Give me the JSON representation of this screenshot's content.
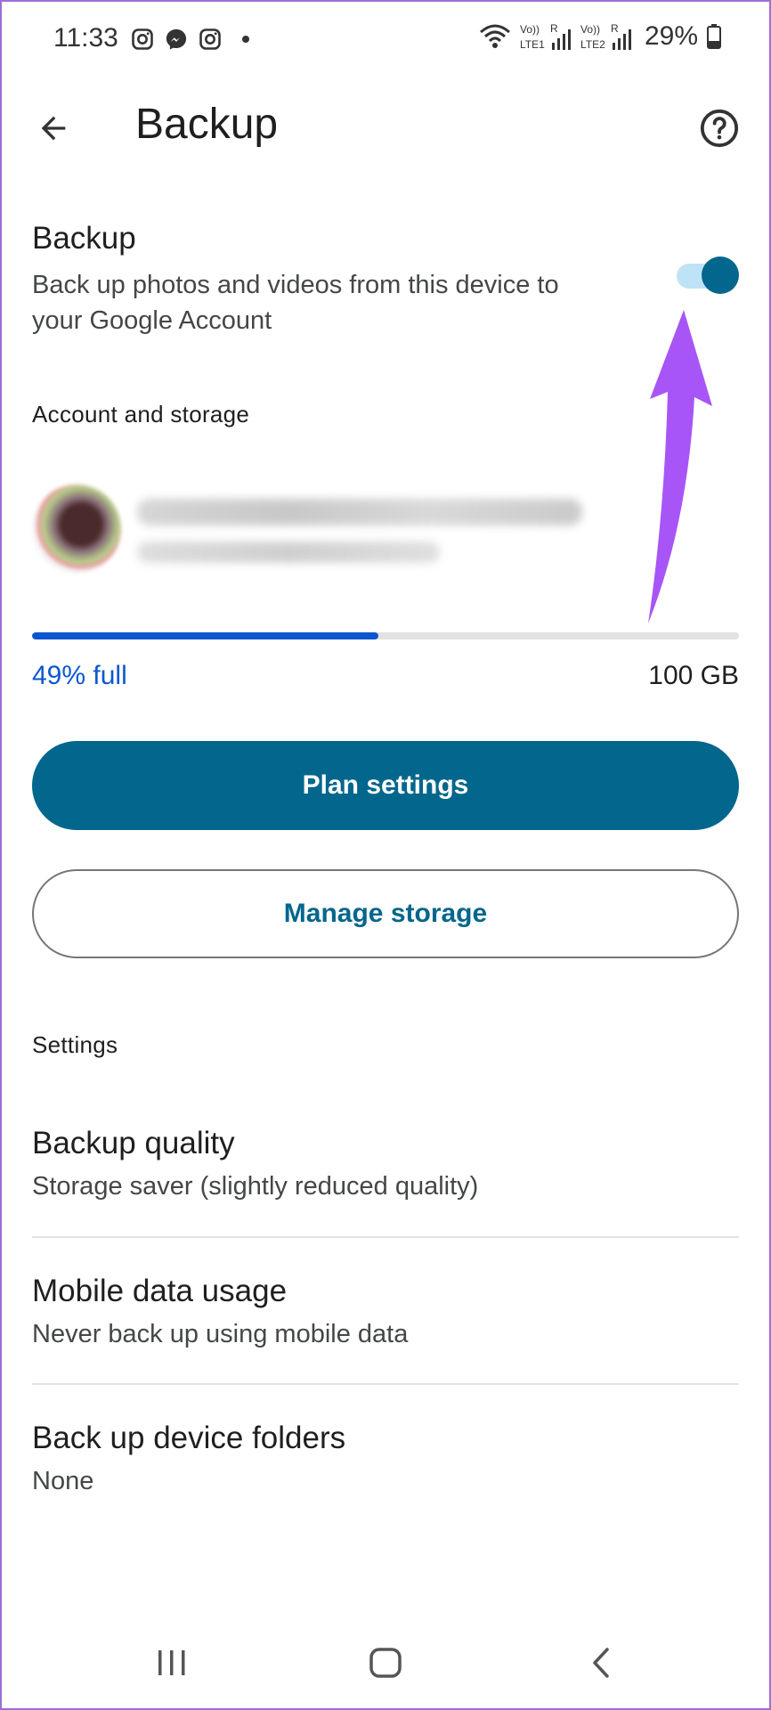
{
  "status_bar": {
    "time": "11:33",
    "battery_percent": "29%",
    "sim1_label": "LTE1",
    "sim2_label": "LTE2",
    "volte_label": "Vo))",
    "roaming_label": "R",
    "left_icons": [
      "instagram-icon",
      "messenger-icon",
      "instagram-icon",
      "notification-dot"
    ]
  },
  "app_bar": {
    "title": "Backup",
    "back_icon": "arrow-back-icon",
    "help_icon": "help-circle-icon"
  },
  "backup_toggle": {
    "title": "Backup",
    "description": "Back up photos and videos from this device to your Google Account",
    "enabled": true
  },
  "account_storage": {
    "header": "Account and storage",
    "storage_used_label": "49% full",
    "storage_used_fraction": 0.49,
    "storage_total_label": "100 GB",
    "plan_settings_label": "Plan settings",
    "manage_storage_label": "Manage storage"
  },
  "settings": {
    "header": "Settings",
    "items": [
      {
        "title": "Backup quality",
        "subtitle": "Storage saver (slightly reduced quality)"
      },
      {
        "title": "Mobile data usage",
        "subtitle": "Never back up using mobile data"
      },
      {
        "title": "Back up device folders",
        "subtitle": "None"
      }
    ]
  },
  "nav_bar": {
    "icons": [
      "recents-icon",
      "home-icon",
      "back-icon"
    ]
  },
  "colors": {
    "accent": "#03668c",
    "progress": "#0b57d0",
    "annotation_arrow": "#a855f7"
  }
}
